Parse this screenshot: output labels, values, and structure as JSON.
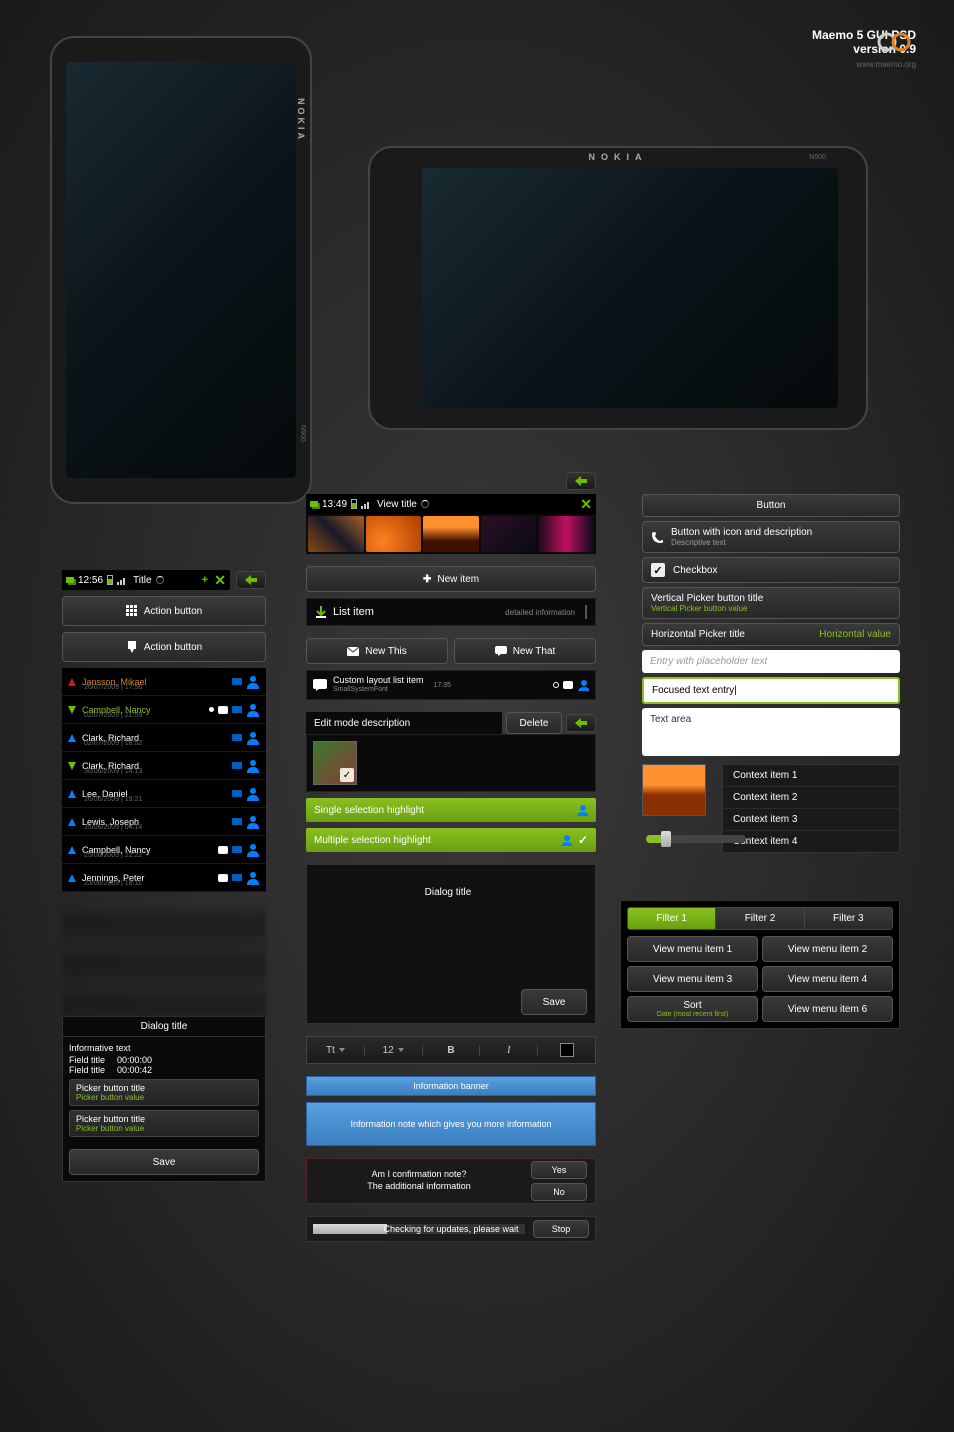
{
  "header": {
    "title": "Maemo 5 GUI PSD",
    "version": "version 0.9",
    "url": "www.maemo.org"
  },
  "phone": {
    "brand": "NOKIA",
    "model": "N900"
  },
  "left": {
    "status": {
      "time": "12:56",
      "title": "Title"
    },
    "action1": "Action button",
    "action2": "Action button",
    "contacts": [
      {
        "name": "Jansson, Mikael",
        "meta": "26/07/2009 | 17:56",
        "dir": "up-red"
      },
      {
        "name": "Campbell, Nancy",
        "meta": "02/07/2009 | 21:59",
        "dir": "down",
        "color": "green",
        "dot": true,
        "bubble": true
      },
      {
        "name": "Clark, Richard",
        "meta": "02/07/2009 | 18:52",
        "dir": "up"
      },
      {
        "name": "Clark, Richard",
        "meta": "30/06/2009 | 14:13",
        "dir": "down"
      },
      {
        "name": "Lee, Daniel",
        "meta": "26/06/2009 | 19:21",
        "dir": "up"
      },
      {
        "name": "Lewis, Joseph",
        "meta": "25/06/2009 | 04:14",
        "dir": "up"
      },
      {
        "name": "Campbell, Nancy",
        "meta": "25/06/2009 | 22:22",
        "dir": "up",
        "bubble": true
      },
      {
        "name": "Jennings, Peter",
        "meta": "23/06/2009 | 18:11",
        "dir": "up",
        "bubble": true
      }
    ],
    "dialog": {
      "title": "Dialog title",
      "info": "Informative text",
      "field1_label": "Field title",
      "field1_value": "00:00:00",
      "field2_label": "Field title",
      "field2_value": "00:00:42",
      "picker1_title": "Picker button title",
      "picker1_value": "Picker button value",
      "picker2_title": "Picker button title",
      "picker2_value": "Picker button value",
      "save": "Save"
    }
  },
  "mid": {
    "status": {
      "time": "13:49",
      "title": "View title"
    },
    "new_item": "New item",
    "list_item": {
      "label": "List item",
      "detail": "detailed information"
    },
    "new_this": "New This",
    "new_that": "New That",
    "custom": {
      "title": "Custom layout list item",
      "sub": "SmallSystemFont",
      "time": "17:35"
    },
    "edit_desc": "Edit mode description",
    "delete": "Delete",
    "single_sel": "Single selection highlight",
    "multi_sel": "Multiple selection highlight",
    "dialog_title": "Dialog title",
    "save": "Save",
    "toolbar": {
      "font": "Tt",
      "size": "12",
      "bold": "B",
      "italic": "I"
    },
    "info_banner": "Information banner",
    "info_note": "Information note which gives you more information",
    "confirm": {
      "q": "Am I confirmation note?",
      "add": "The additional information",
      "yes": "Yes",
      "no": "No"
    },
    "progress": {
      "label": "Checking for updates, please wait",
      "stop": "Stop"
    }
  },
  "right": {
    "button": "Button",
    "icon_btn": {
      "title": "Button with icon and description",
      "desc": "Descriptive text"
    },
    "checkbox": "Checkbox",
    "vpicker": {
      "title": "Vertical Picker button title",
      "value": "Vertical Picker button value"
    },
    "hpicker": {
      "title": "Horizontal Picker title",
      "value": "Horizontal value"
    },
    "entry_placeholder": "Entry with placeholder text",
    "entry_focused": "Focused text entry",
    "textarea": "Text area",
    "context": [
      "Context item 1",
      "Context item 2",
      "Context item 3",
      "Context item 4"
    ],
    "filters": [
      "Filter 1",
      "Filter 2",
      "Filter 3"
    ],
    "menu": [
      "View menu item 1",
      "View menu item 2",
      "View menu item 3",
      "View menu item 4"
    ],
    "sort": {
      "label": "Sort",
      "value": "Date (most recent first)"
    },
    "menu6": "View menu item 6"
  }
}
